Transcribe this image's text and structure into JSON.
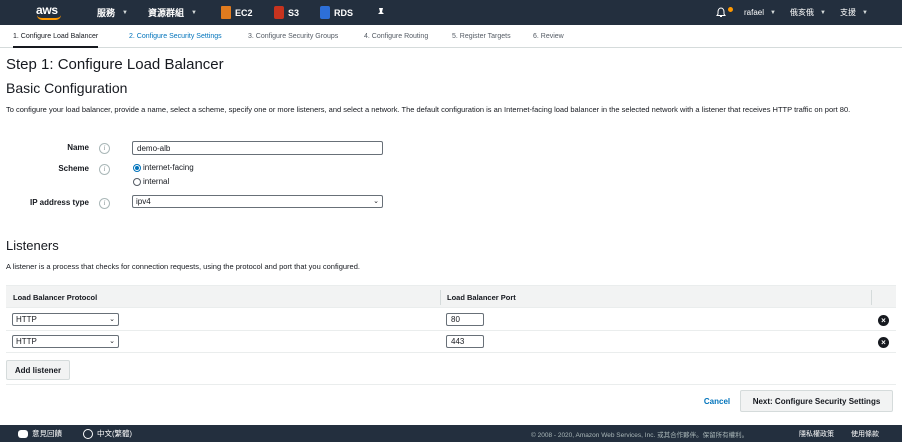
{
  "nav": {
    "logo_text": "aws",
    "services_label": "服務",
    "resource_groups_label": "資源群組",
    "ec2_label": "EC2",
    "s3_label": "S3",
    "rds_label": "RDS",
    "user_label": "rafael",
    "region_label": "俄亥俄",
    "support_label": "支援"
  },
  "steps": [
    "1. Configure Load Balancer",
    "2. Configure Security Settings",
    "3. Configure Security Groups",
    "4. Configure Routing",
    "5. Register Targets",
    "6. Review"
  ],
  "page": {
    "title": "Step 1: Configure Load Balancer",
    "section_title": "Basic Configuration",
    "description": "To configure your load balancer, provide a name, select a scheme, specify one or more listeners, and select a network. The default configuration is an Internet-facing load balancer in the selected network with a listener that receives HTTP traffic on port 80."
  },
  "form": {
    "name_label": "Name",
    "name_value": "demo-alb",
    "scheme_label": "Scheme",
    "scheme_options": [
      "internet-facing",
      "internal"
    ],
    "scheme_selected": "internet-facing",
    "ip_label": "IP address type",
    "ip_value": "ipv4"
  },
  "listeners": {
    "title": "Listeners",
    "description": "A listener is a process that checks for connection requests, using the protocol and port that you configured.",
    "col_protocol": "Load Balancer Protocol",
    "col_port": "Load Balancer Port",
    "rows": [
      {
        "protocol": "HTTP",
        "port": "80"
      },
      {
        "protocol": "HTTP",
        "port": "443"
      }
    ],
    "add_label": "Add listener"
  },
  "actions": {
    "cancel_label": "Cancel",
    "next_label": "Next: Configure Security Settings"
  },
  "footer": {
    "feedback_label": "意見回饋",
    "language_label": "中文(繁體)",
    "copyright": "© 2008 - 2020, Amazon Web Services, Inc. 或其合作夥伴。保留所有權利。",
    "privacy_label": "隱私權政策",
    "terms_label": "使用條款"
  },
  "colors": {
    "nav_bg": "#232f3e",
    "accent": "#ff9900",
    "link": "#0073bb"
  }
}
